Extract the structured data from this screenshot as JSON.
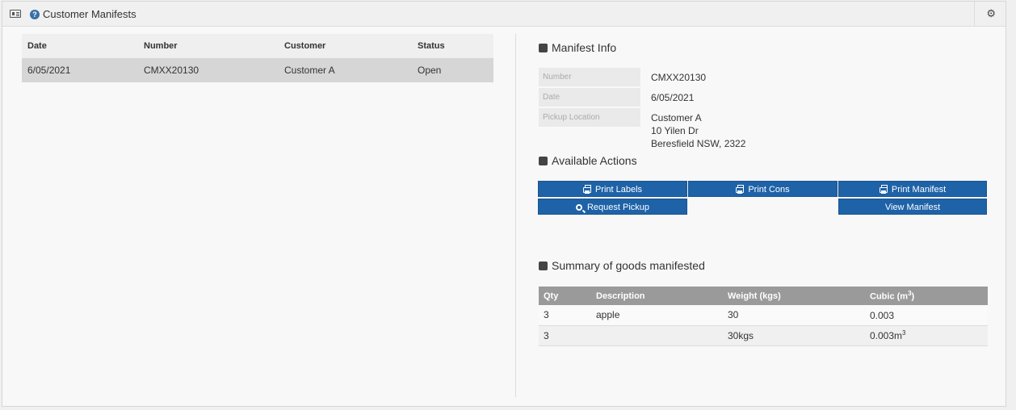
{
  "header": {
    "title": "Customer Manifests"
  },
  "list": {
    "columns": [
      "Date",
      "Number",
      "Customer",
      "Status"
    ],
    "rows": [
      {
        "date": "6/05/2021",
        "number": "CMXX20130",
        "customer": "Customer A",
        "status": "Open"
      }
    ]
  },
  "manifest_info": {
    "title": "Manifest Info",
    "number_label": "Number",
    "number": "CMXX20130",
    "date_label": "Date",
    "date": "6/05/2021",
    "pickup_label": "Pickup Location",
    "pickup_line1": "Customer A",
    "pickup_line2": "10 Yilen Dr",
    "pickup_line3": "Beresfield NSW, 2322"
  },
  "actions": {
    "title": "Available Actions",
    "print_labels": "Print Labels",
    "print_cons": "Print Cons",
    "print_manifest": "Print Manifest",
    "request_pickup": "Request Pickup",
    "view_manifest": "View Manifest"
  },
  "goods": {
    "title": "Summary of goods manifested",
    "col_qty": "Qty",
    "col_description": "Description",
    "col_weight": "Weight (kgs)",
    "col_cubic": "Cubic (m",
    "col_cubic_sup": "3",
    "col_cubic_end": ")",
    "rows": [
      {
        "qty": "3",
        "description": "apple",
        "weight": "30",
        "cubic": "0.003",
        "cubic_sup": ""
      },
      {
        "qty": "3",
        "description": "",
        "weight": "30kgs",
        "cubic": "0.003m",
        "cubic_sup": "3"
      }
    ]
  }
}
